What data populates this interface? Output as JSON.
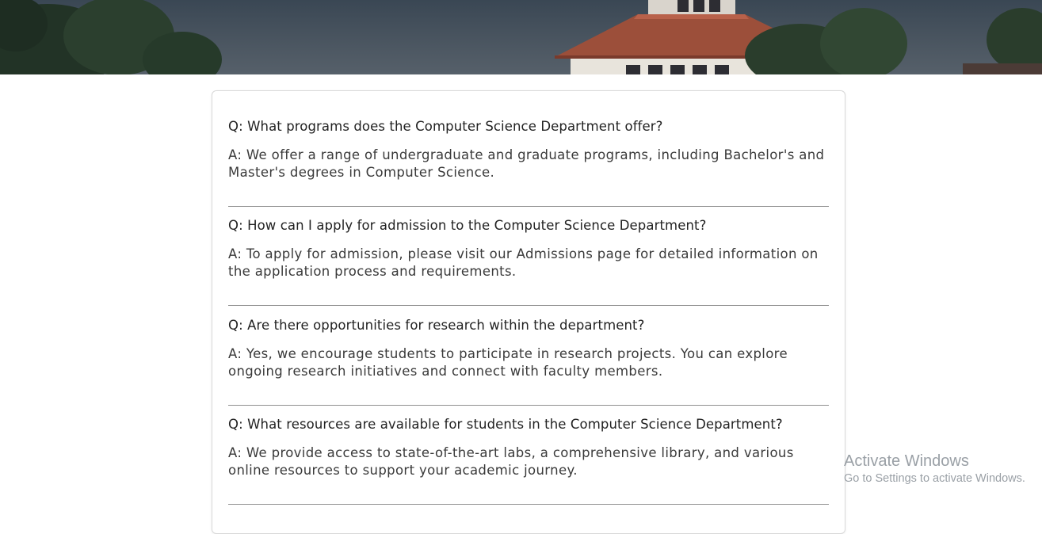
{
  "faq": [
    {
      "question": "Q: What programs does the Computer Science Department offer?",
      "answer": "A: We offer a range of undergraduate and graduate programs, including Bachelor's and Master's degrees in Computer Science."
    },
    {
      "question": "Q: How can I apply for admission to the Computer Science Department?",
      "answer": "A: To apply for admission, please visit our Admissions page for detailed information on the application process and requirements."
    },
    {
      "question": "Q: Are there opportunities for research within the department?",
      "answer": "A: Yes, we encourage students to participate in research projects. You can explore ongoing research initiatives and connect with faculty members."
    },
    {
      "question": "Q: What resources are available for students in the Computer Science Department?",
      "answer": "A: We provide access to state-of-the-art labs, a comprehensive library, and various online resources to support your academic journey."
    }
  ],
  "watermark": {
    "title": "Activate Windows",
    "subtitle": "Go to Settings to activate Windows."
  }
}
